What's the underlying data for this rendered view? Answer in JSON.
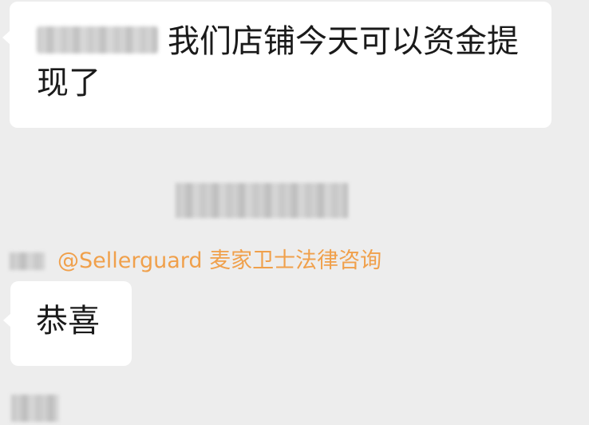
{
  "messages": [
    {
      "text": "我们店铺今天可以资金提现了"
    },
    {
      "mention": "@Sellerguard 麦家卫士法律咨询",
      "text": "恭喜"
    }
  ],
  "colors": {
    "background": "#ededed",
    "bubble": "#ffffff",
    "mention": "#f0a04b",
    "text": "#1a1a1a"
  }
}
